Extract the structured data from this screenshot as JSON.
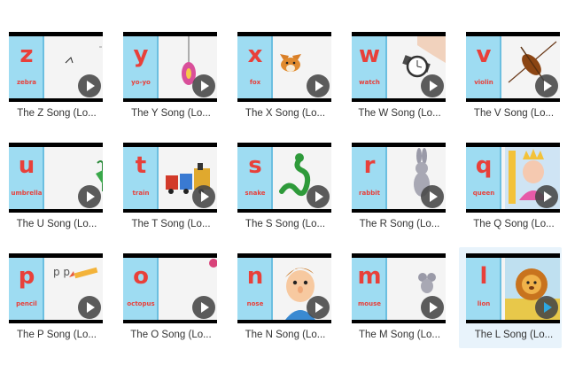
{
  "videos": [
    {
      "letter": "z",
      "word": "zebra",
      "title": "The Z Song (Lo..."
    },
    {
      "letter": "y",
      "word": "yo-yo",
      "title": "The Y Song (Lo..."
    },
    {
      "letter": "x",
      "word": "fox",
      "title": "The X Song (Lo..."
    },
    {
      "letter": "w",
      "word": "watch",
      "title": "The W Song (Lo..."
    },
    {
      "letter": "v",
      "word": "violin",
      "title": "The V Song (Lo..."
    },
    {
      "letter": "u",
      "word": "umbrella",
      "title": "The U Song (Lo..."
    },
    {
      "letter": "t",
      "word": "train",
      "title": "The T Song (Lo..."
    },
    {
      "letter": "s",
      "word": "snake",
      "title": "The S Song (Lo..."
    },
    {
      "letter": "r",
      "word": "rabbit",
      "title": "The R Song (Lo..."
    },
    {
      "letter": "q",
      "word": "queen",
      "title": "The Q Song (Lo..."
    },
    {
      "letter": "p",
      "word": "pencil",
      "title": "The P Song (Lo..."
    },
    {
      "letter": "o",
      "word": "octopus",
      "title": "The O Song (Lo..."
    },
    {
      "letter": "n",
      "word": "nose",
      "title": "The N Song (Lo..."
    },
    {
      "letter": "m",
      "word": "mouse",
      "title": "The M Song (Lo..."
    },
    {
      "letter": "l",
      "word": "lion",
      "title": "The L Song (Lo..."
    }
  ],
  "pencil_pic_text": "p p",
  "selected_index": 14
}
